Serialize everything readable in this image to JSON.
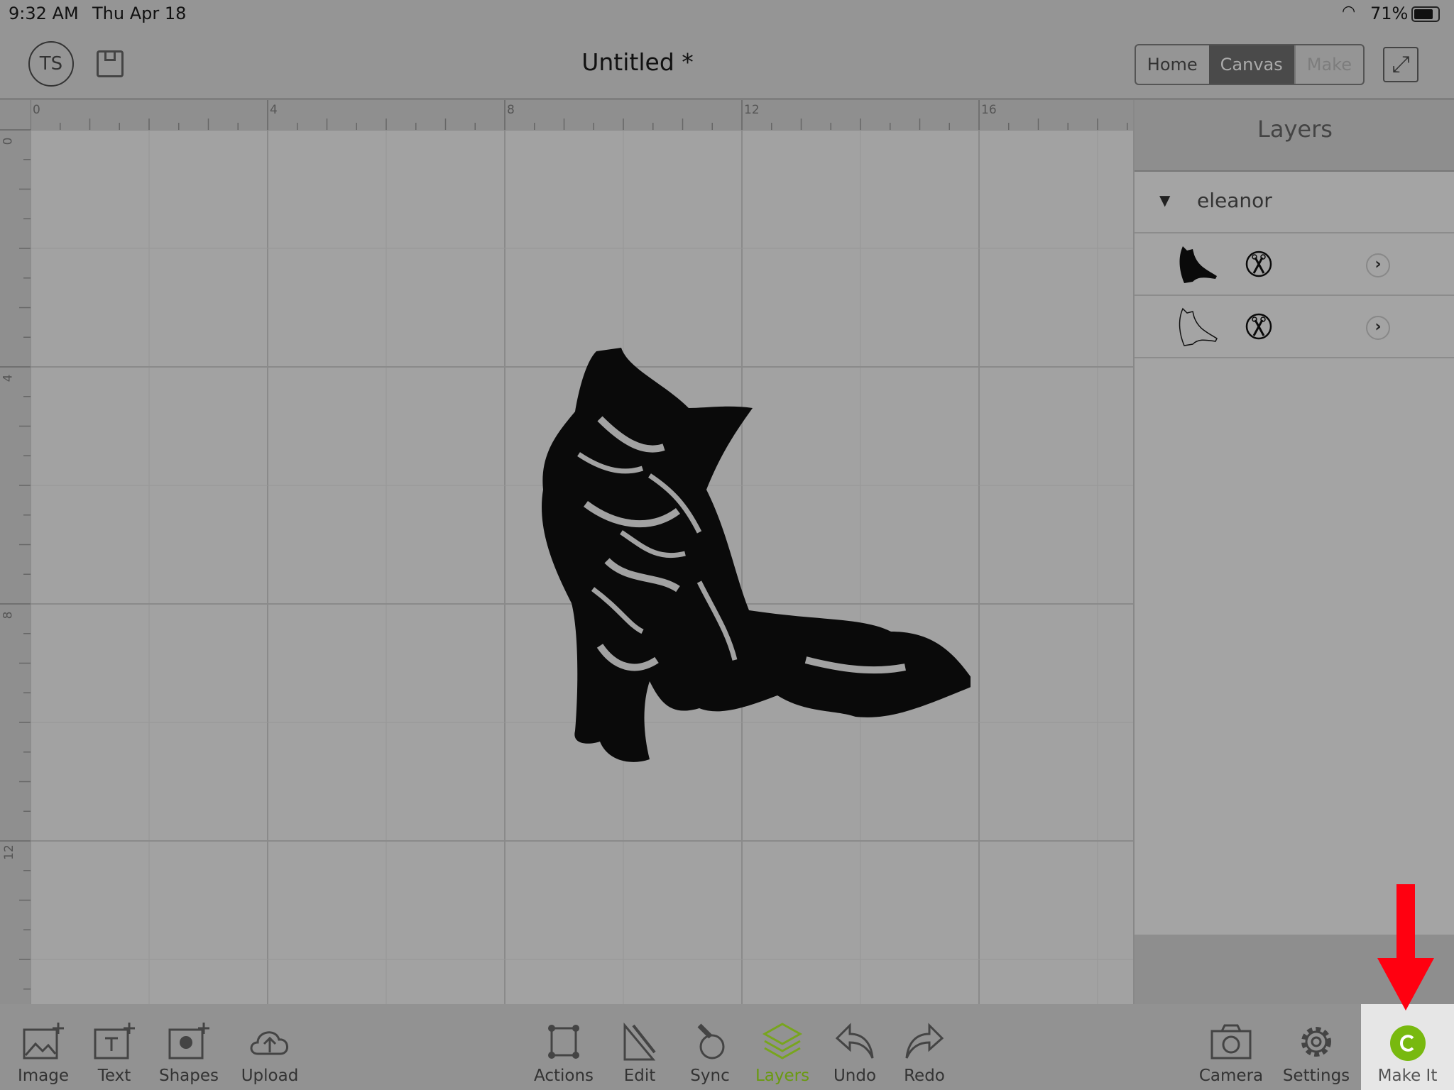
{
  "status_bar": {
    "time": "9:32 AM",
    "date": "Thu Apr 18",
    "battery": "71%"
  },
  "header": {
    "avatar": "TS",
    "title": "Untitled *",
    "tabs": [
      {
        "label": "Home",
        "state": "normal"
      },
      {
        "label": "Canvas",
        "state": "active"
      },
      {
        "label": "Make",
        "state": "disabled"
      }
    ]
  },
  "ruler": {
    "top_labels": [
      "0",
      "4",
      "8",
      "12",
      "16"
    ],
    "left_labels": [
      "0",
      "4",
      "8",
      "12"
    ]
  },
  "layers_panel": {
    "title": "Layers",
    "group": {
      "name": "eleanor",
      "expanded": true
    },
    "layers": [
      {
        "thumbnail": "cat-filled",
        "operation": "cut-icon"
      },
      {
        "thumbnail": "cat-outline",
        "operation": "cut-icon"
      }
    ]
  },
  "toolbar": {
    "left": [
      "Image",
      "Text",
      "Shapes",
      "Upload"
    ],
    "center": [
      "Actions",
      "Edit",
      "Sync",
      "Layers",
      "Undo",
      "Redo"
    ],
    "right": [
      "Camera",
      "Settings",
      "Make It"
    ],
    "active": "Layers"
  },
  "colors": {
    "accent": "#78a51e",
    "annotation_arrow": "#ff0000"
  }
}
